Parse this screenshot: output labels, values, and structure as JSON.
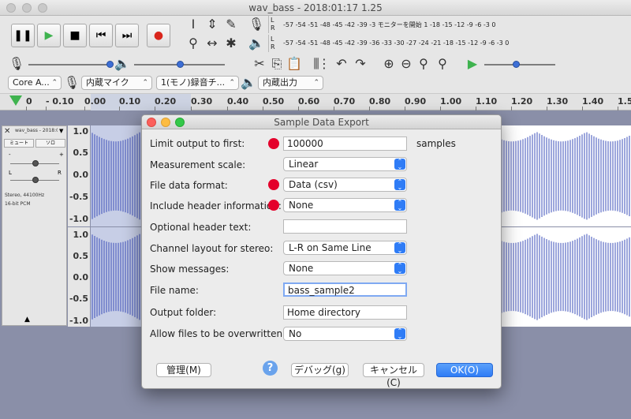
{
  "window": {
    "title": "wav_bass - 2018:01:17 1.25"
  },
  "transport": {
    "pause_icon": "pause-icon",
    "play_icon": "play-icon",
    "stop_icon": "stop-icon",
    "skip_start_icon": "skip-to-start-icon",
    "skip_end_icon": "skip-to-end-icon",
    "record_icon": "record-icon",
    "colors": {
      "play": "#3fb34f",
      "record": "#d9261c"
    }
  },
  "meters": {
    "record": {
      "left": "L",
      "right": "R",
      "scale": "-57 -54 -51 -48 -45 -42 -39 -3 モニターを開始 1 -18 -15 -12 -9 -6 -3 0"
    },
    "playback": {
      "left": "L",
      "right": "R",
      "scale": "-57 -54 -51 -48 -45 -42 -39 -36 -33 -30 -27 -24 -21 -18 -15 -12 -9 -6 -3 0"
    }
  },
  "devices": {
    "host": "Core A...",
    "input": "内蔵マイク",
    "channels": "1(モノ)録音チ...",
    "output": "内蔵出力"
  },
  "ruler": {
    "labels": [
      "0",
      "- 0.10",
      "0.00",
      "0.10",
      "0.20",
      "0.30",
      "0.40",
      "0.50",
      "0.60",
      "0.70",
      "0.80",
      "0.90",
      "1.00",
      "1.10",
      "1.20",
      "1.30",
      "1.40",
      "1.5"
    ]
  },
  "track": {
    "name": "wav_bass - 2018:0",
    "mute": "ミュート",
    "solo": "ソロ",
    "gain_minus": "-",
    "gain_plus": "+",
    "pan_l": "L",
    "pan_r": "R",
    "format": "Stereo, 44100Hz",
    "bits": "16-bit PCM",
    "scale": [
      "1.0",
      "0.5",
      "0.0",
      "-0.5",
      "-1.0"
    ]
  },
  "dialog": {
    "title": "Sample Data Export",
    "limit_label": "Limit output to first:",
    "limit_value": "100000",
    "limit_unit": "samples",
    "measurement_label": "Measurement scale:",
    "measurement_value": "Linear",
    "format_label": "File data format:",
    "format_value": "Data (csv)",
    "header_label": "Include header information:",
    "header_value": "None",
    "optional_header_label": "Optional header text:",
    "optional_header_value": "",
    "channel_label": "Channel layout for stereo:",
    "channel_value": "L-R on Same Line",
    "messages_label": "Show messages:",
    "messages_value": "None",
    "filename_label": "File name:",
    "filename_value": "bass_sample2",
    "folder_label": "Output folder:",
    "folder_value": "Home directory",
    "overwrite_label": "Allow files to be overwritten:",
    "overwrite_value": "No",
    "manage_button": "管理(M)",
    "help_icon": "?",
    "debug_button": "デバッグ(g)",
    "cancel_button": "キャンセル(C)",
    "ok_button": "OK(O)",
    "colors": {
      "marker": "#e4002b",
      "accent": "#2f7cf6"
    }
  }
}
